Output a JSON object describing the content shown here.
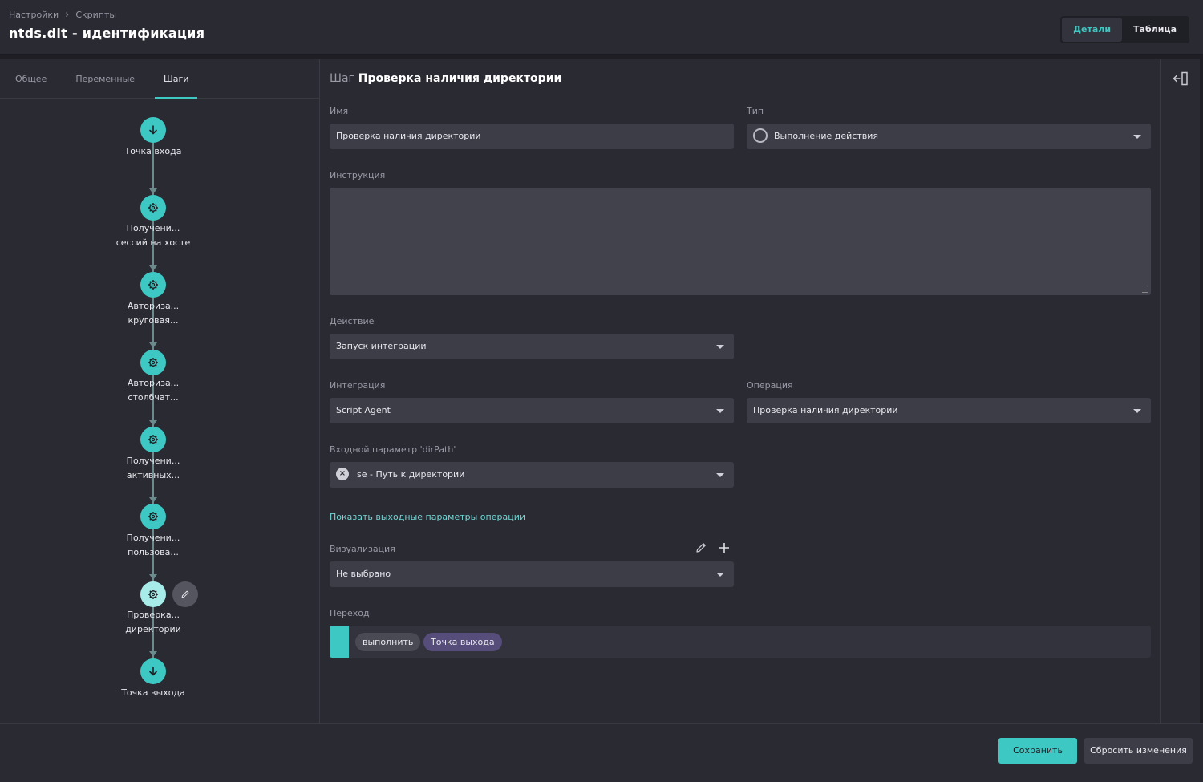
{
  "header": {
    "breadcrumb": [
      "Настройки",
      "Скрипты"
    ],
    "title": "ntds.dit - идентификация",
    "view_tabs": [
      "Детали",
      "Таблица"
    ],
    "active_view": "Детали"
  },
  "left": {
    "tabs": [
      "Общее",
      "Переменные",
      "Шаги"
    ],
    "active_tab": "Шаги",
    "steps": [
      {
        "lines": [
          "Точка входа"
        ],
        "kind": "entry"
      },
      {
        "lines": [
          "Получени...",
          "сессий на хосте"
        ],
        "kind": "action"
      },
      {
        "lines": [
          "Авториза...",
          "круговая..."
        ],
        "kind": "action"
      },
      {
        "lines": [
          "Авториза...",
          "столбчат..."
        ],
        "kind": "action"
      },
      {
        "lines": [
          "Получени...",
          "активных..."
        ],
        "kind": "action"
      },
      {
        "lines": [
          "Получени...",
          "пользова..."
        ],
        "kind": "action"
      },
      {
        "lines": [
          "Проверка...",
          "директории"
        ],
        "kind": "action",
        "selected": true
      },
      {
        "lines": [
          "Точка выхода"
        ],
        "kind": "exit"
      }
    ]
  },
  "main": {
    "title_prefix": "Шаг",
    "title": "Проверка наличия директории",
    "name_label": "Имя",
    "name_value": "Проверка наличия директории",
    "type_label": "Тип",
    "type_value": "Выполнение действия",
    "instruction_label": "Инструкция",
    "action_label": "Действие",
    "action_value": "Запуск интеграции",
    "integration_label": "Интеграция",
    "integration_value": "Script Agent",
    "operation_label": "Операция",
    "operation_value": "Проверка наличия директории",
    "input_param_label": "Входной параметр 'dirPath'",
    "input_param_value": "se - Путь к директории",
    "show_output_link": "Показать выходные параметры операции",
    "visualization_label": "Визуализация",
    "visualization_value": "Не выбрано",
    "transition_label": "Переход",
    "transition_action": "выполнить",
    "transition_target": "Точка выхода"
  },
  "footer": {
    "save": "Сохранить",
    "reset": "Сбросить изменения"
  },
  "colors": {
    "accent": "#3ec8c3",
    "background": "#2a2a33",
    "field": "#3d3d48",
    "chip_target": "#574d7a"
  }
}
